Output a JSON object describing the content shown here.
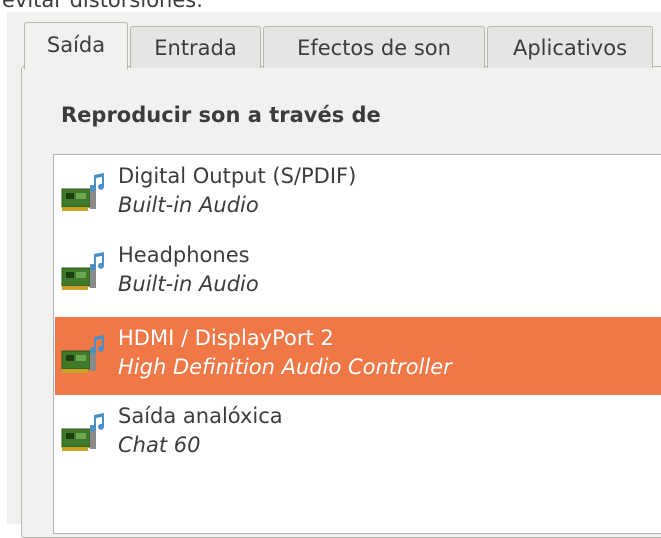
{
  "top_text": "evitar distorsiones.",
  "tabs": [
    {
      "label": "Saída",
      "active": true
    },
    {
      "label": "Entrada",
      "active": false
    },
    {
      "label": "Efectos de son",
      "active": false
    },
    {
      "label": "Aplicativos",
      "active": false
    }
  ],
  "section_heading": "Reproducir son a través de",
  "devices": [
    {
      "name": "Digital Output (S/PDIF)",
      "description": "Built-in Audio",
      "icon": "sound-card-icon",
      "selected": false
    },
    {
      "name": "Headphones",
      "description": "Built-in Audio",
      "icon": "sound-card-icon",
      "selected": false
    },
    {
      "name": "HDMI / DisplayPort 2",
      "description": "High Definition Audio Controller",
      "icon": "sound-card-icon",
      "selected": true
    },
    {
      "name": "Saída analóxica",
      "description": "Chat 60",
      "icon": "sound-card-icon",
      "selected": false
    }
  ],
  "colors": {
    "selection": "#f07746",
    "window_bg": "#f2f1f0",
    "border": "#b9b7b3",
    "text": "#3c3c3c"
  }
}
